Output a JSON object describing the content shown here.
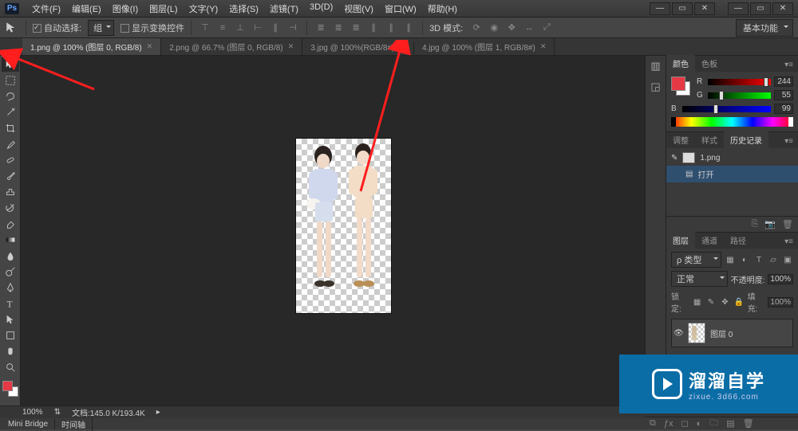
{
  "app": {
    "logo": "Ps"
  },
  "menus": [
    "文件(F)",
    "编辑(E)",
    "图像(I)",
    "图层(L)",
    "文字(Y)",
    "选择(S)",
    "滤镜(T)",
    "3D(D)",
    "视图(V)",
    "窗口(W)",
    "帮助(H)"
  ],
  "options": {
    "auto_select_label": "自动选择:",
    "auto_select_value": "组",
    "show_transform_label": "显示变换控件",
    "mode_label": "3D 模式:"
  },
  "workspace_button": "基本功能",
  "doc_tabs": [
    {
      "label": "1.png @ 100% (图层 0, RGB/8)",
      "active": true
    },
    {
      "label": "2.png @ 66.7% (图层 0, RGB/8)",
      "active": false
    },
    {
      "label": "3.jpg @ 100%(RGB/8#)",
      "active": false
    },
    {
      "label": "4.jpg @ 100% (图层 1, RGB/8#)",
      "active": false
    }
  ],
  "color_panel": {
    "tabs": [
      "颜色",
      "色板"
    ],
    "r": 244,
    "g": 55,
    "b": 99
  },
  "mid_panel_tabs": [
    "调整",
    "样式",
    "历史记录"
  ],
  "history": {
    "snapshot": "1.png",
    "steps": [
      "打开"
    ]
  },
  "layers_panel": {
    "tabs": [
      "图层",
      "通道",
      "路径"
    ],
    "kind_label": "ρ 类型",
    "blend_mode": "正常",
    "opacity_label": "不透明度:",
    "opacity_value": "100%",
    "lock_label": "锁定:",
    "fill_label": "填充:",
    "fill_value": "100%",
    "layer_name": "图层 0"
  },
  "status": {
    "zoom": "100%",
    "doc_info": "文档:145.0 K/193.4K"
  },
  "bottom_tabs": [
    "Mini Bridge",
    "时间轴"
  ],
  "watermark": {
    "big": "溜溜自学",
    "small": "zixue. 3d66.com"
  }
}
